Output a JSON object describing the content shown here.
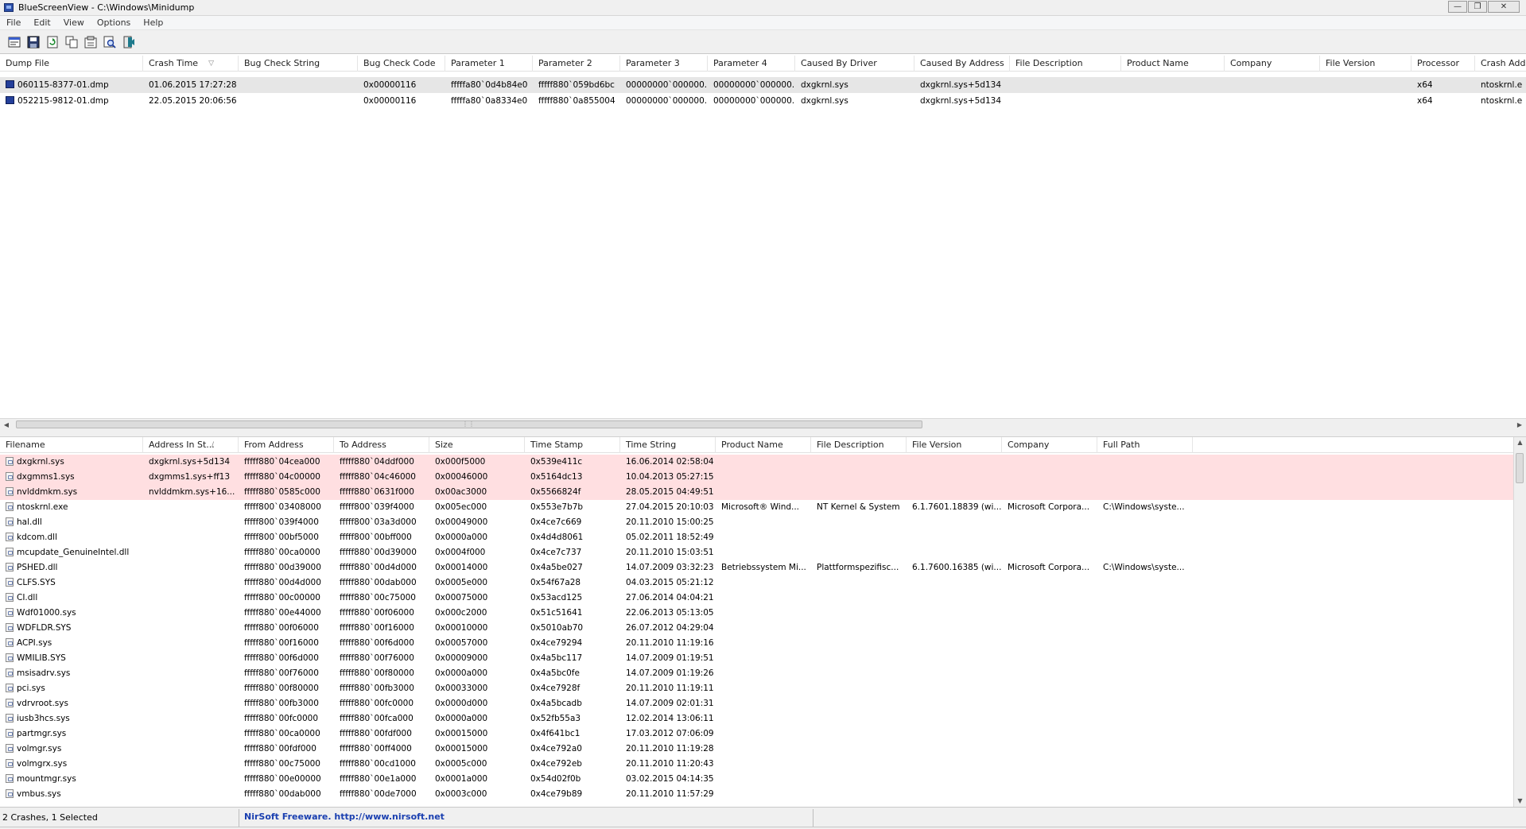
{
  "window": {
    "title": "BlueScreenView  -  C:\\Windows\\Minidump",
    "min": "—",
    "max": "❐",
    "close": "✕"
  },
  "menu": [
    "File",
    "Edit",
    "View",
    "Options",
    "Help"
  ],
  "toolbar": [
    "properties-icon",
    "save-icon",
    "refresh-icon",
    "copy-icon",
    "html-report-icon",
    "find-icon",
    "exit-icon"
  ],
  "crash_list": {
    "columns": [
      "Dump File",
      "Crash Time",
      "Bug Check String",
      "Bug Check Code",
      "Parameter 1",
      "Parameter 2",
      "Parameter 3",
      "Parameter 4",
      "Caused By Driver",
      "Caused By Address",
      "File Description",
      "Product Name",
      "Company",
      "File Version",
      "Processor",
      "Crash Add"
    ],
    "sort_indicator": "▽",
    "rows": [
      [
        "060115-8377-01.dmp",
        "01.06.2015 17:27:28",
        "",
        "0x00000116",
        "fffffa80`0d4b84e0",
        "fffff880`059bd6bc",
        "00000000`000000...",
        "00000000`000000...",
        "dxgkrnl.sys",
        "dxgkrnl.sys+5d134",
        "",
        "",
        "",
        "",
        "x64",
        "ntoskrnl.e"
      ],
      [
        "052215-9812-01.dmp",
        "22.05.2015 20:06:56",
        "",
        "0x00000116",
        "fffffa80`0a8334e0",
        "fffff880`0a855004",
        "00000000`000000...",
        "00000000`000000...",
        "dxgkrnl.sys",
        "dxgkrnl.sys+5d134",
        "",
        "",
        "",
        "",
        "x64",
        "ntoskrnl.e"
      ]
    ]
  },
  "module_list": {
    "columns": [
      "Filename",
      "Address In St...",
      "From Address",
      "To Address",
      "Size",
      "Time Stamp",
      "Time String",
      "Product Name",
      "File Description",
      "File Version",
      "Company",
      "Full Path"
    ],
    "sort_indicator": "/",
    "rows": [
      [
        "dxgkrnl.sys",
        "dxgkrnl.sys+5d134",
        "fffff880`04cea000",
        "fffff880`04ddf000",
        "0x000f5000",
        "0x539e411c",
        "16.06.2014 02:58:04",
        "",
        "",
        "",
        "",
        ""
      ],
      [
        "dxgmms1.sys",
        "dxgmms1.sys+ff13",
        "fffff880`04c00000",
        "fffff880`04c46000",
        "0x00046000",
        "0x5164dc13",
        "10.04.2013 05:27:15",
        "",
        "",
        "",
        "",
        ""
      ],
      [
        "nvlddmkm.sys",
        "nvlddmkm.sys+16...",
        "fffff880`0585c000",
        "fffff880`0631f000",
        "0x00ac3000",
        "0x5566824f",
        "28.05.2015 04:49:51",
        "",
        "",
        "",
        "",
        ""
      ],
      [
        "ntoskrnl.exe",
        "",
        "fffff800`03408000",
        "fffff800`039f4000",
        "0x005ec000",
        "0x553e7b7b",
        "27.04.2015 20:10:03",
        "Microsoft® Wind...",
        "NT Kernel & System",
        "6.1.7601.18839 (wi...",
        "Microsoft Corpora...",
        "C:\\Windows\\syste..."
      ],
      [
        "hal.dll",
        "",
        "fffff800`039f4000",
        "fffff800`03a3d000",
        "0x00049000",
        "0x4ce7c669",
        "20.11.2010 15:00:25",
        "",
        "",
        "",
        "",
        ""
      ],
      [
        "kdcom.dll",
        "",
        "fffff800`00bf5000",
        "fffff800`00bff000",
        "0x0000a000",
        "0x4d4d8061",
        "05.02.2011 18:52:49",
        "",
        "",
        "",
        "",
        ""
      ],
      [
        "mcupdate_GenuineIntel.dll",
        "",
        "fffff880`00ca0000",
        "fffff880`00d39000",
        "0x0004f000",
        "0x4ce7c737",
        "20.11.2010 15:03:51",
        "",
        "",
        "",
        "",
        ""
      ],
      [
        "PSHED.dll",
        "",
        "fffff880`00d39000",
        "fffff880`00d4d000",
        "0x00014000",
        "0x4a5be027",
        "14.07.2009 03:32:23",
        "Betriebssystem Mi...",
        "Plattformspezifisc...",
        "6.1.7600.16385 (wi...",
        "Microsoft Corpora...",
        "C:\\Windows\\syste..."
      ],
      [
        "CLFS.SYS",
        "",
        "fffff880`00d4d000",
        "fffff880`00dab000",
        "0x0005e000",
        "0x54f67a28",
        "04.03.2015 05:21:12",
        "",
        "",
        "",
        "",
        ""
      ],
      [
        "CI.dll",
        "",
        "fffff880`00c00000",
        "fffff880`00c75000",
        "0x00075000",
        "0x53acd125",
        "27.06.2014 04:04:21",
        "",
        "",
        "",
        "",
        ""
      ],
      [
        "Wdf01000.sys",
        "",
        "fffff880`00e44000",
        "fffff880`00f06000",
        "0x000c2000",
        "0x51c51641",
        "22.06.2013 05:13:05",
        "",
        "",
        "",
        "",
        ""
      ],
      [
        "WDFLDR.SYS",
        "",
        "fffff880`00f06000",
        "fffff880`00f16000",
        "0x00010000",
        "0x5010ab70",
        "26.07.2012 04:29:04",
        "",
        "",
        "",
        "",
        ""
      ],
      [
        "ACPI.sys",
        "",
        "fffff880`00f16000",
        "fffff880`00f6d000",
        "0x00057000",
        "0x4ce79294",
        "20.11.2010 11:19:16",
        "",
        "",
        "",
        "",
        ""
      ],
      [
        "WMILIB.SYS",
        "",
        "fffff880`00f6d000",
        "fffff880`00f76000",
        "0x00009000",
        "0x4a5bc117",
        "14.07.2009 01:19:51",
        "",
        "",
        "",
        "",
        ""
      ],
      [
        "msisadrv.sys",
        "",
        "fffff880`00f76000",
        "fffff880`00f80000",
        "0x0000a000",
        "0x4a5bc0fe",
        "14.07.2009 01:19:26",
        "",
        "",
        "",
        "",
        ""
      ],
      [
        "pci.sys",
        "",
        "fffff880`00f80000",
        "fffff880`00fb3000",
        "0x00033000",
        "0x4ce7928f",
        "20.11.2010 11:19:11",
        "",
        "",
        "",
        "",
        ""
      ],
      [
        "vdrvroot.sys",
        "",
        "fffff880`00fb3000",
        "fffff880`00fc0000",
        "0x0000d000",
        "0x4a5bcadb",
        "14.07.2009 02:01:31",
        "",
        "",
        "",
        "",
        ""
      ],
      [
        "iusb3hcs.sys",
        "",
        "fffff880`00fc0000",
        "fffff880`00fca000",
        "0x0000a000",
        "0x52fb55a3",
        "12.02.2014 13:06:11",
        "",
        "",
        "",
        "",
        ""
      ],
      [
        "partmgr.sys",
        "",
        "fffff880`00ca0000",
        "fffff880`00fdf000",
        "0x00015000",
        "0x4f641bc1",
        "17.03.2012 07:06:09",
        "",
        "",
        "",
        "",
        ""
      ],
      [
        "volmgr.sys",
        "",
        "fffff880`00fdf000",
        "fffff880`00ff4000",
        "0x00015000",
        "0x4ce792a0",
        "20.11.2010 11:19:28",
        "",
        "",
        "",
        "",
        ""
      ],
      [
        "volmgrx.sys",
        "",
        "fffff880`00c75000",
        "fffff880`00cd1000",
        "0x0005c000",
        "0x4ce792eb",
        "20.11.2010 11:20:43",
        "",
        "",
        "",
        "",
        ""
      ],
      [
        "mountmgr.sys",
        "",
        "fffff880`00e00000",
        "fffff880`00e1a000",
        "0x0001a000",
        "0x54d02f0b",
        "03.02.2015 04:14:35",
        "",
        "",
        "",
        "",
        ""
      ],
      [
        "vmbus.sys",
        "",
        "fffff880`00dab000",
        "fffff880`00de7000",
        "0x0003c000",
        "0x4ce79b89",
        "20.11.2010 11:57:29",
        "",
        "",
        "",
        "",
        ""
      ]
    ]
  },
  "status": {
    "crashes": "2 Crashes, 1 Selected",
    "link": "NirSoft Freeware.  http://www.nirsoft.net"
  },
  "colors": {
    "highlight_row": "#ffdfe1",
    "selected_row": "#e6e6e6",
    "link": "#1a3fb0"
  }
}
